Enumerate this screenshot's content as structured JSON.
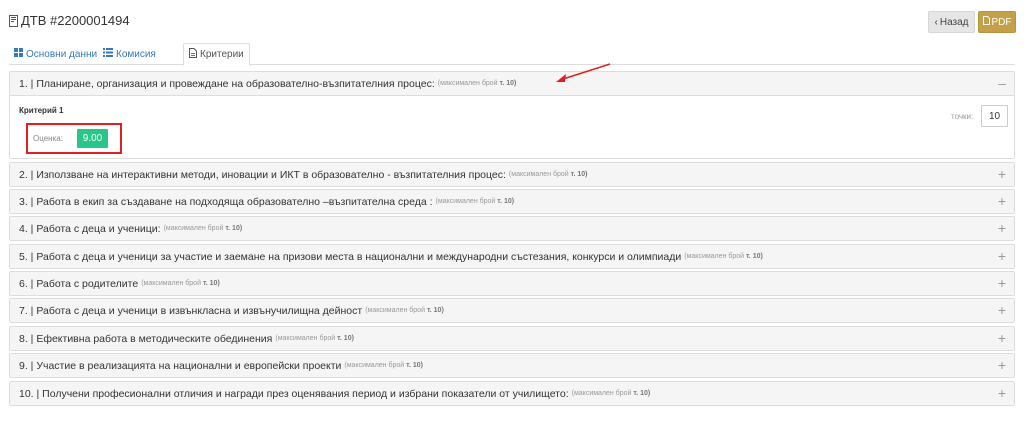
{
  "header": {
    "title": "ДТВ #2200001494",
    "back_label": "Назад",
    "pdf_label": "PDF"
  },
  "tabs": [
    {
      "label": "Основни данни",
      "icon": "grid-icon",
      "active": false
    },
    {
      "label": "Комисия",
      "icon": "list-icon",
      "active": false
    },
    {
      "label": "Критерии",
      "icon": "document-icon",
      "active": true
    }
  ],
  "max_prefix": "(максимален брой",
  "max_value": "т. 10)",
  "panels": [
    {
      "title": "1. | Планиране, организация и провеждане на образователно-възпитателния процес:",
      "expanded": true
    },
    {
      "title": "2. | Използване на интерактивни методи, иновации и ИКТ в образователно - възпитателния процес:",
      "expanded": false
    },
    {
      "title": "3. | Работа в екип за създаване на подходяща образователно –възпитателна среда :",
      "expanded": false
    },
    {
      "title": "4. | Работа с деца и ученици:",
      "expanded": false
    },
    {
      "title": "5. | Работа с деца и ученици за участие и заемане на призови места в национални и международни състезания, конкурси и олимпиади",
      "expanded": false
    },
    {
      "title": "6. | Работа с родителите",
      "expanded": false
    },
    {
      "title": "7. | Работа с деца и ученици в извънкласна и извънучилищна дейност",
      "expanded": false
    },
    {
      "title": "8. | Ефективна работа в методическите обединения",
      "expanded": false
    },
    {
      "title": "9. | Участие в реализацията на национални и европейски проекти",
      "expanded": false
    },
    {
      "title": "10. | Получени професионални отличия и награди през оценявания период и избрани показатели от училището:",
      "expanded": false
    }
  ],
  "criterion": {
    "title": "Критерий 1",
    "grade_label": "Оценка:",
    "grade_value": "9.00",
    "points_label": "точки:",
    "points_value": "10"
  },
  "colors": {
    "accent": "#337ab7",
    "grade": "#27c78a",
    "pdf": "#c4a04a",
    "highlight": "#e02020"
  }
}
